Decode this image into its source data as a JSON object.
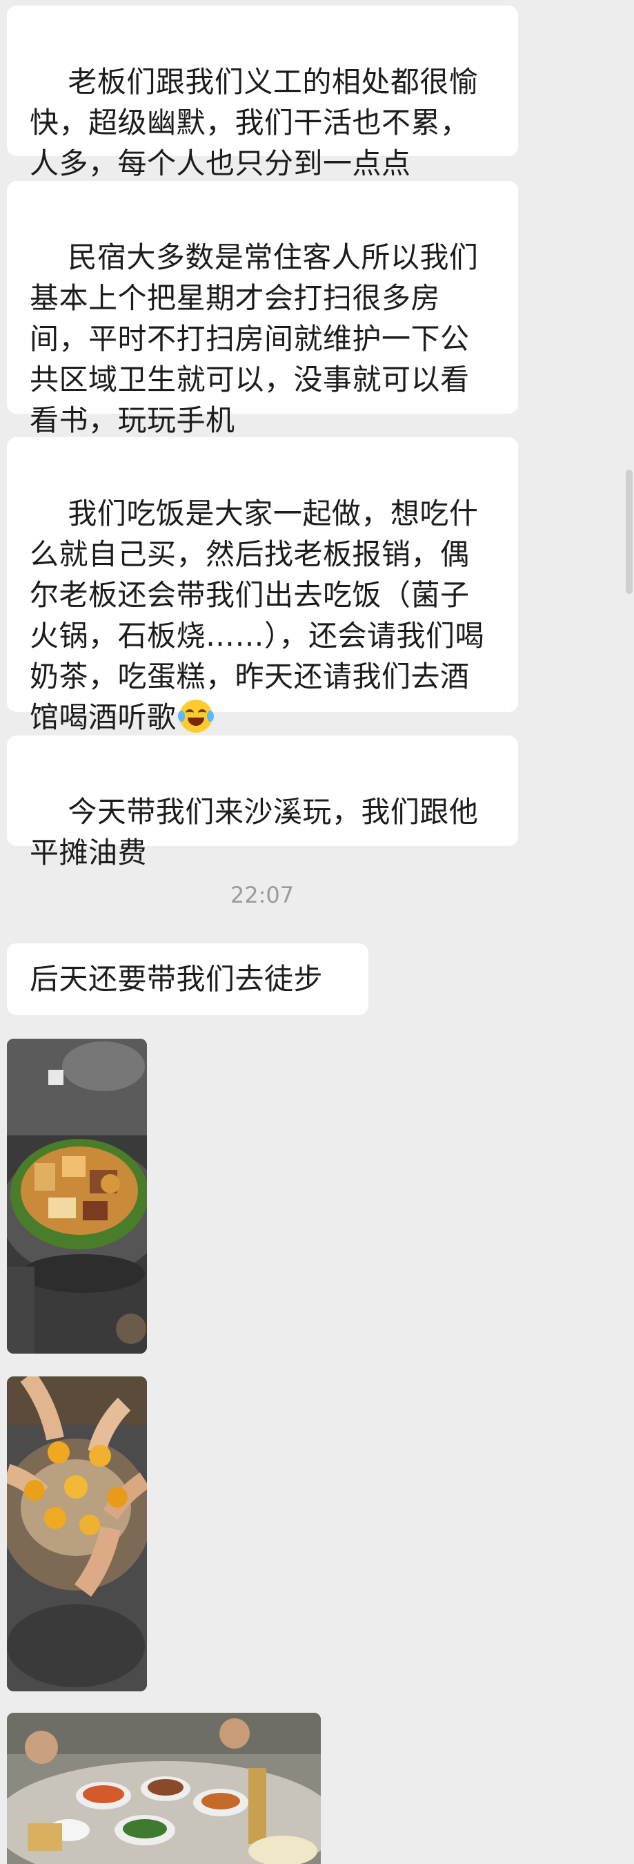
{
  "messages": [
    {
      "text": "老板们跟我们义工的相处都很愉快，超级幽默，我们干活也不累，人多，每个人也只分到一点点"
    },
    {
      "text": "民宿大多数是常住客人所以我们基本上个把星期才会打扫很多房间，平时不打扫房间就维护一下公共区域卫生就可以，没事就可以看看书，玩玩手机"
    },
    {
      "text": "我们吃饭是大家一起做，想吃什么就自己买，然后找老板报销，偶尔老板还会带我们出去吃饭（菌子火锅，石板烧……），还会请我们喝奶茶，吃蛋糕，昨天还请我们去酒馆喝酒听歌",
      "emoji": "tears-of-joy"
    },
    {
      "text": "今天带我们来沙溪玩，我们跟他平摊油费"
    }
  ],
  "timestamp": "22:07",
  "messages_after": [
    {
      "text": "后天还要带我们去徒步"
    }
  ],
  "photos": [
    {
      "name": "hotpot-photo"
    },
    {
      "name": "toast-photo"
    },
    {
      "name": "dinner-table-photo"
    }
  ],
  "colors": {
    "background": "#ededed",
    "bubble": "#ffffff",
    "text": "#1c1c1c",
    "timestamp": "#9b9b9b"
  }
}
